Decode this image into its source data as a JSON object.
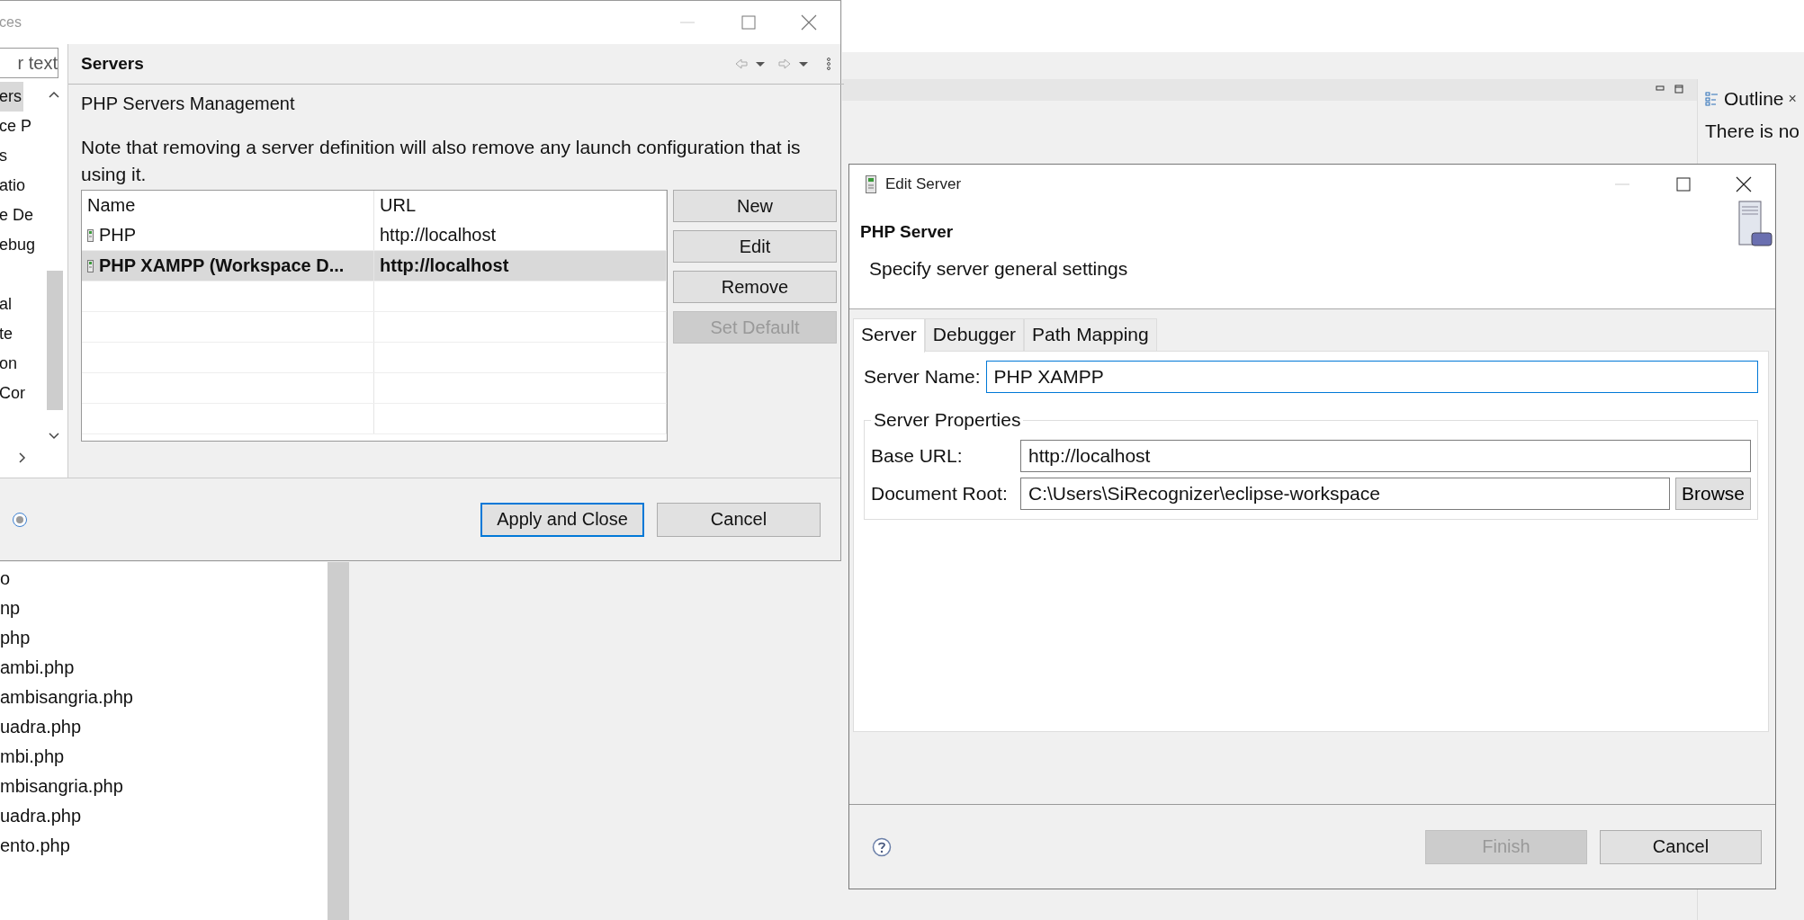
{
  "preferences": {
    "title": "ces",
    "filter": {
      "placeholder": "r text"
    },
    "tree_items": [
      {
        "label": "ers",
        "selected": true
      },
      {
        "label": "ce P",
        "selected": false
      },
      {
        "label": "s",
        "selected": false
      },
      {
        "label": "atio",
        "selected": false
      },
      {
        "label": "e De",
        "selected": false
      },
      {
        "label": "ebug",
        "selected": false
      },
      {
        "label": "al",
        "selected": false
      },
      {
        "label": "te",
        "selected": false
      },
      {
        "label": "on",
        "selected": false
      },
      {
        "label": "Cor",
        "selected": false
      }
    ],
    "page_title": "Servers",
    "heading": "PHP Servers Management",
    "note": "Note that removing a server definition will also remove any launch configuration that is using it.",
    "table": {
      "columns": [
        "Name",
        "URL"
      ],
      "rows": [
        {
          "name": "PHP",
          "url": "http://localhost",
          "selected": false,
          "default": false
        },
        {
          "name": "PHP XAMPP (Workspace D...",
          "url": "http://localhost",
          "selected": true,
          "default": true
        }
      ]
    },
    "buttons": [
      {
        "label": "New",
        "disabled": false
      },
      {
        "label": "Edit",
        "disabled": false
      },
      {
        "label": "Remove",
        "disabled": false
      },
      {
        "label": "Set Default",
        "disabled": true
      }
    ],
    "footer_buttons": [
      {
        "label": "Apply and Close",
        "default": true
      },
      {
        "label": "Cancel",
        "default": false
      }
    ]
  },
  "file_list": [
    "o",
    "np",
    "php",
    "ambi.php",
    "ambisangria.php",
    "uadra.php",
    "mbi.php",
    "mbisangria.php",
    "uadra.php",
    "ento.php"
  ],
  "outline": {
    "title": "Outline",
    "close": "×",
    "message": "There is no"
  },
  "edit_server": {
    "title": "Edit Server",
    "heading": "PHP Server",
    "description": "Specify server general settings",
    "tabs": [
      {
        "label": "Server",
        "selected": true
      },
      {
        "label": "Debugger",
        "selected": false
      },
      {
        "label": "Path Mapping",
        "selected": false
      }
    ],
    "server_name": {
      "label": "Server Name:",
      "value": "PHP XAMPP",
      "focused": true
    },
    "group": {
      "title": "Server Properties",
      "fields": [
        {
          "label": "Base URL:",
          "value": "http://localhost"
        },
        {
          "label": "Document Root:",
          "value": "C:\\Users\\SiRecognizer\\eclipse-workspace",
          "button": "Browse"
        }
      ]
    },
    "footer_buttons": [
      {
        "label": "Finish",
        "disabled": true
      },
      {
        "label": "Cancel",
        "disabled": false
      }
    ]
  }
}
